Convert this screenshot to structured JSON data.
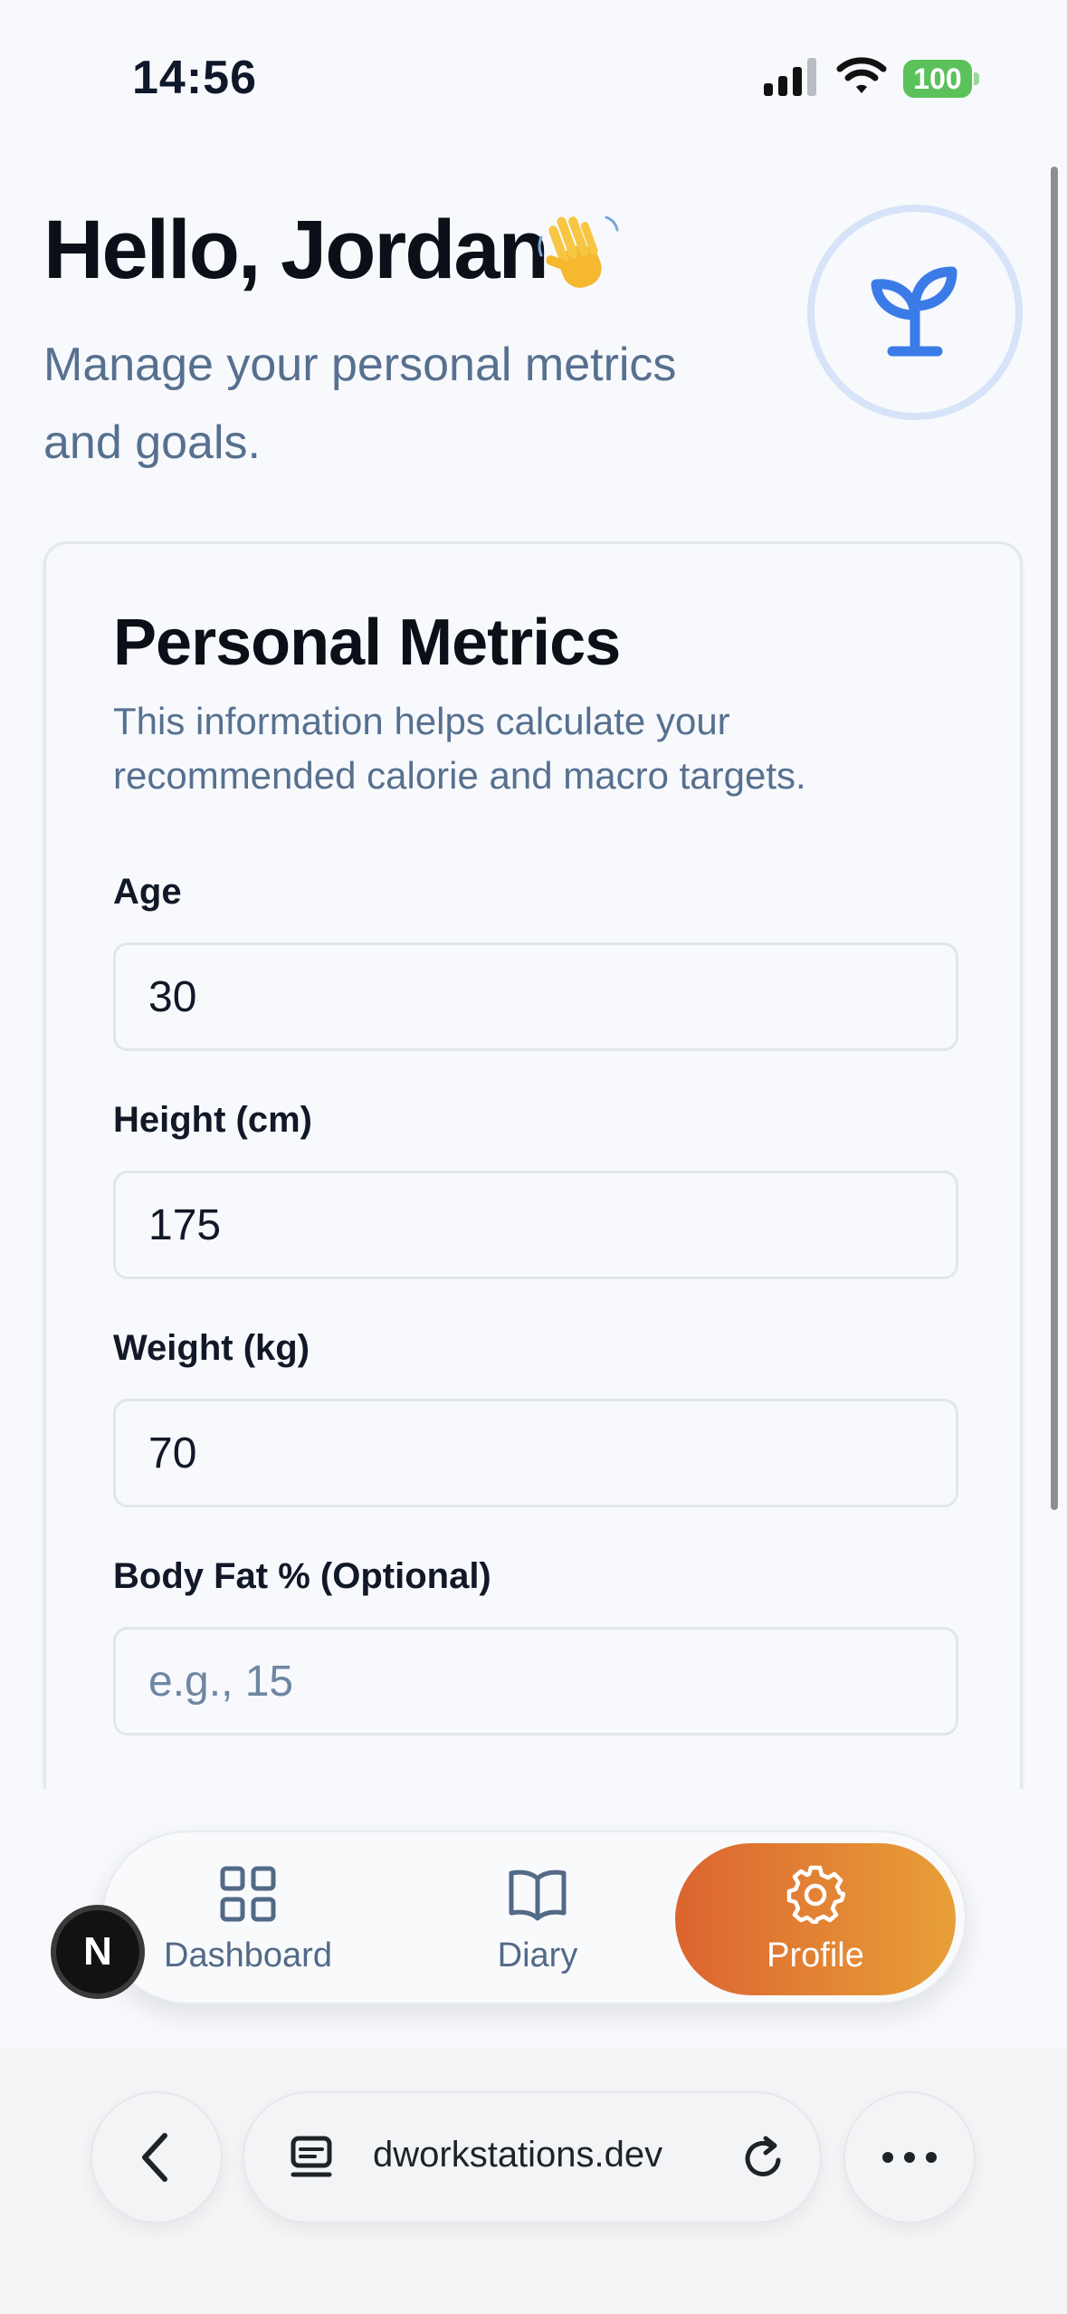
{
  "status_bar": {
    "time": "14:56",
    "battery": "100"
  },
  "header": {
    "greeting": "Hello, Jordan",
    "subtitle": "Manage your personal metrics and goals."
  },
  "card": {
    "title": "Personal Metrics",
    "description": "This information helps calculate your recommended calorie and macro targets.",
    "fields": [
      {
        "label": "Age",
        "value": "30",
        "placeholder": ""
      },
      {
        "label": "Height (cm)",
        "value": "175",
        "placeholder": ""
      },
      {
        "label": "Weight (kg)",
        "value": "70",
        "placeholder": ""
      },
      {
        "label": "Body Fat % (Optional)",
        "value": "",
        "placeholder": "e.g., 15"
      }
    ]
  },
  "tabbar": {
    "items": [
      {
        "label": "Dashboard",
        "icon": "grid-icon",
        "active": false
      },
      {
        "label": "Diary",
        "icon": "book-icon",
        "active": false
      },
      {
        "label": "Profile",
        "icon": "gear-icon",
        "active": true
      }
    ],
    "badge": "N"
  },
  "browser": {
    "url": "dworkstations.dev"
  },
  "colors": {
    "accent_start": "#dc6430",
    "accent_end": "#e8a038",
    "logo_blue": "#3b7be8",
    "muted_text": "#57708f"
  }
}
